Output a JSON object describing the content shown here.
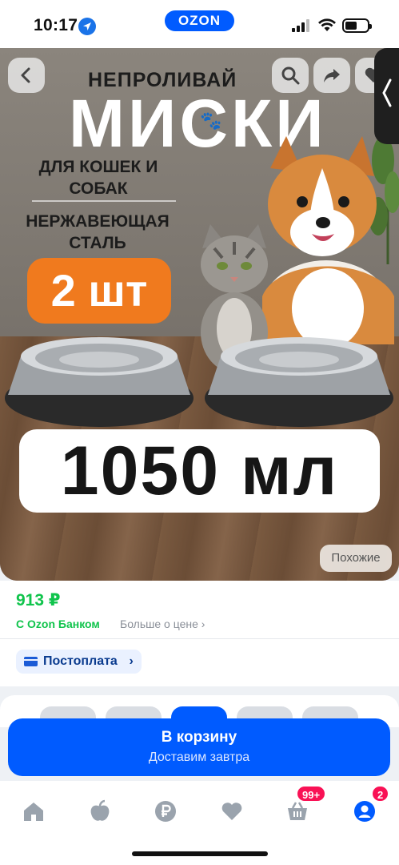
{
  "status_bar": {
    "time": "10:17",
    "app_badge": "OZON"
  },
  "hero": {
    "headline_small": "НЕПРОЛИВАЙ",
    "headline_big": "МИСКИ",
    "for_whom": "ДЛЯ КОШЕК И СОБАК",
    "material": "НЕРЖАВЕЮЩАЯ СТАЛЬ",
    "quantity_badge": "2 шт",
    "volume": "1050 мл",
    "similar_button": "Похожие"
  },
  "product": {
    "price": "913 ₽",
    "bank_label": "С Ozon Банком",
    "more_about_price": "Больше о цене ›",
    "postpay_label": "Постоплата"
  },
  "cart": {
    "button_label": "В корзину",
    "delivery_note": "Доставим завтра"
  },
  "tabbar": {
    "items": [
      "home",
      "fresh",
      "ozon-bank",
      "favorites",
      "cart",
      "profile"
    ],
    "cart_badge": "99+",
    "profile_badge": "2"
  },
  "colors": {
    "brand": "#005bff",
    "price_green": "#10c44c",
    "badge_pink": "#f91155",
    "accent_orange": "#f07a1e"
  }
}
